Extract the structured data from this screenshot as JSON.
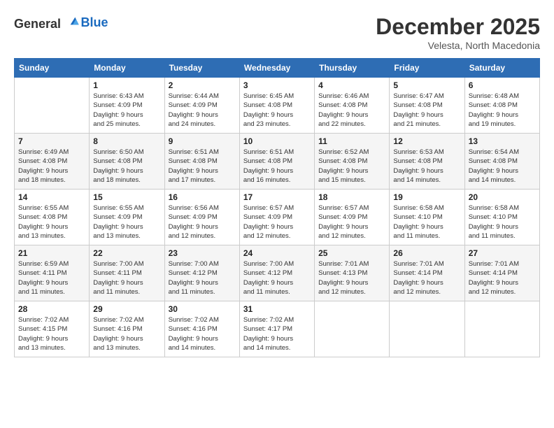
{
  "header": {
    "logo_general": "General",
    "logo_blue": "Blue",
    "month": "December 2025",
    "location": "Velesta, North Macedonia"
  },
  "days_of_week": [
    "Sunday",
    "Monday",
    "Tuesday",
    "Wednesday",
    "Thursday",
    "Friday",
    "Saturday"
  ],
  "weeks": [
    [
      {
        "day": "",
        "info": ""
      },
      {
        "day": "1",
        "info": "Sunrise: 6:43 AM\nSunset: 4:09 PM\nDaylight: 9 hours\nand 25 minutes."
      },
      {
        "day": "2",
        "info": "Sunrise: 6:44 AM\nSunset: 4:09 PM\nDaylight: 9 hours\nand 24 minutes."
      },
      {
        "day": "3",
        "info": "Sunrise: 6:45 AM\nSunset: 4:08 PM\nDaylight: 9 hours\nand 23 minutes."
      },
      {
        "day": "4",
        "info": "Sunrise: 6:46 AM\nSunset: 4:08 PM\nDaylight: 9 hours\nand 22 minutes."
      },
      {
        "day": "5",
        "info": "Sunrise: 6:47 AM\nSunset: 4:08 PM\nDaylight: 9 hours\nand 21 minutes."
      },
      {
        "day": "6",
        "info": "Sunrise: 6:48 AM\nSunset: 4:08 PM\nDaylight: 9 hours\nand 19 minutes."
      }
    ],
    [
      {
        "day": "7",
        "info": "Sunrise: 6:49 AM\nSunset: 4:08 PM\nDaylight: 9 hours\nand 18 minutes."
      },
      {
        "day": "8",
        "info": "Sunrise: 6:50 AM\nSunset: 4:08 PM\nDaylight: 9 hours\nand 18 minutes."
      },
      {
        "day": "9",
        "info": "Sunrise: 6:51 AM\nSunset: 4:08 PM\nDaylight: 9 hours\nand 17 minutes."
      },
      {
        "day": "10",
        "info": "Sunrise: 6:51 AM\nSunset: 4:08 PM\nDaylight: 9 hours\nand 16 minutes."
      },
      {
        "day": "11",
        "info": "Sunrise: 6:52 AM\nSunset: 4:08 PM\nDaylight: 9 hours\nand 15 minutes."
      },
      {
        "day": "12",
        "info": "Sunrise: 6:53 AM\nSunset: 4:08 PM\nDaylight: 9 hours\nand 14 minutes."
      },
      {
        "day": "13",
        "info": "Sunrise: 6:54 AM\nSunset: 4:08 PM\nDaylight: 9 hours\nand 14 minutes."
      }
    ],
    [
      {
        "day": "14",
        "info": "Sunrise: 6:55 AM\nSunset: 4:08 PM\nDaylight: 9 hours\nand 13 minutes."
      },
      {
        "day": "15",
        "info": "Sunrise: 6:55 AM\nSunset: 4:09 PM\nDaylight: 9 hours\nand 13 minutes."
      },
      {
        "day": "16",
        "info": "Sunrise: 6:56 AM\nSunset: 4:09 PM\nDaylight: 9 hours\nand 12 minutes."
      },
      {
        "day": "17",
        "info": "Sunrise: 6:57 AM\nSunset: 4:09 PM\nDaylight: 9 hours\nand 12 minutes."
      },
      {
        "day": "18",
        "info": "Sunrise: 6:57 AM\nSunset: 4:09 PM\nDaylight: 9 hours\nand 12 minutes."
      },
      {
        "day": "19",
        "info": "Sunrise: 6:58 AM\nSunset: 4:10 PM\nDaylight: 9 hours\nand 11 minutes."
      },
      {
        "day": "20",
        "info": "Sunrise: 6:58 AM\nSunset: 4:10 PM\nDaylight: 9 hours\nand 11 minutes."
      }
    ],
    [
      {
        "day": "21",
        "info": "Sunrise: 6:59 AM\nSunset: 4:11 PM\nDaylight: 9 hours\nand 11 minutes."
      },
      {
        "day": "22",
        "info": "Sunrise: 7:00 AM\nSunset: 4:11 PM\nDaylight: 9 hours\nand 11 minutes."
      },
      {
        "day": "23",
        "info": "Sunrise: 7:00 AM\nSunset: 4:12 PM\nDaylight: 9 hours\nand 11 minutes."
      },
      {
        "day": "24",
        "info": "Sunrise: 7:00 AM\nSunset: 4:12 PM\nDaylight: 9 hours\nand 11 minutes."
      },
      {
        "day": "25",
        "info": "Sunrise: 7:01 AM\nSunset: 4:13 PM\nDaylight: 9 hours\nand 12 minutes."
      },
      {
        "day": "26",
        "info": "Sunrise: 7:01 AM\nSunset: 4:14 PM\nDaylight: 9 hours\nand 12 minutes."
      },
      {
        "day": "27",
        "info": "Sunrise: 7:01 AM\nSunset: 4:14 PM\nDaylight: 9 hours\nand 12 minutes."
      }
    ],
    [
      {
        "day": "28",
        "info": "Sunrise: 7:02 AM\nSunset: 4:15 PM\nDaylight: 9 hours\nand 13 minutes."
      },
      {
        "day": "29",
        "info": "Sunrise: 7:02 AM\nSunset: 4:16 PM\nDaylight: 9 hours\nand 13 minutes."
      },
      {
        "day": "30",
        "info": "Sunrise: 7:02 AM\nSunset: 4:16 PM\nDaylight: 9 hours\nand 14 minutes."
      },
      {
        "day": "31",
        "info": "Sunrise: 7:02 AM\nSunset: 4:17 PM\nDaylight: 9 hours\nand 14 minutes."
      },
      {
        "day": "",
        "info": ""
      },
      {
        "day": "",
        "info": ""
      },
      {
        "day": "",
        "info": ""
      }
    ]
  ]
}
